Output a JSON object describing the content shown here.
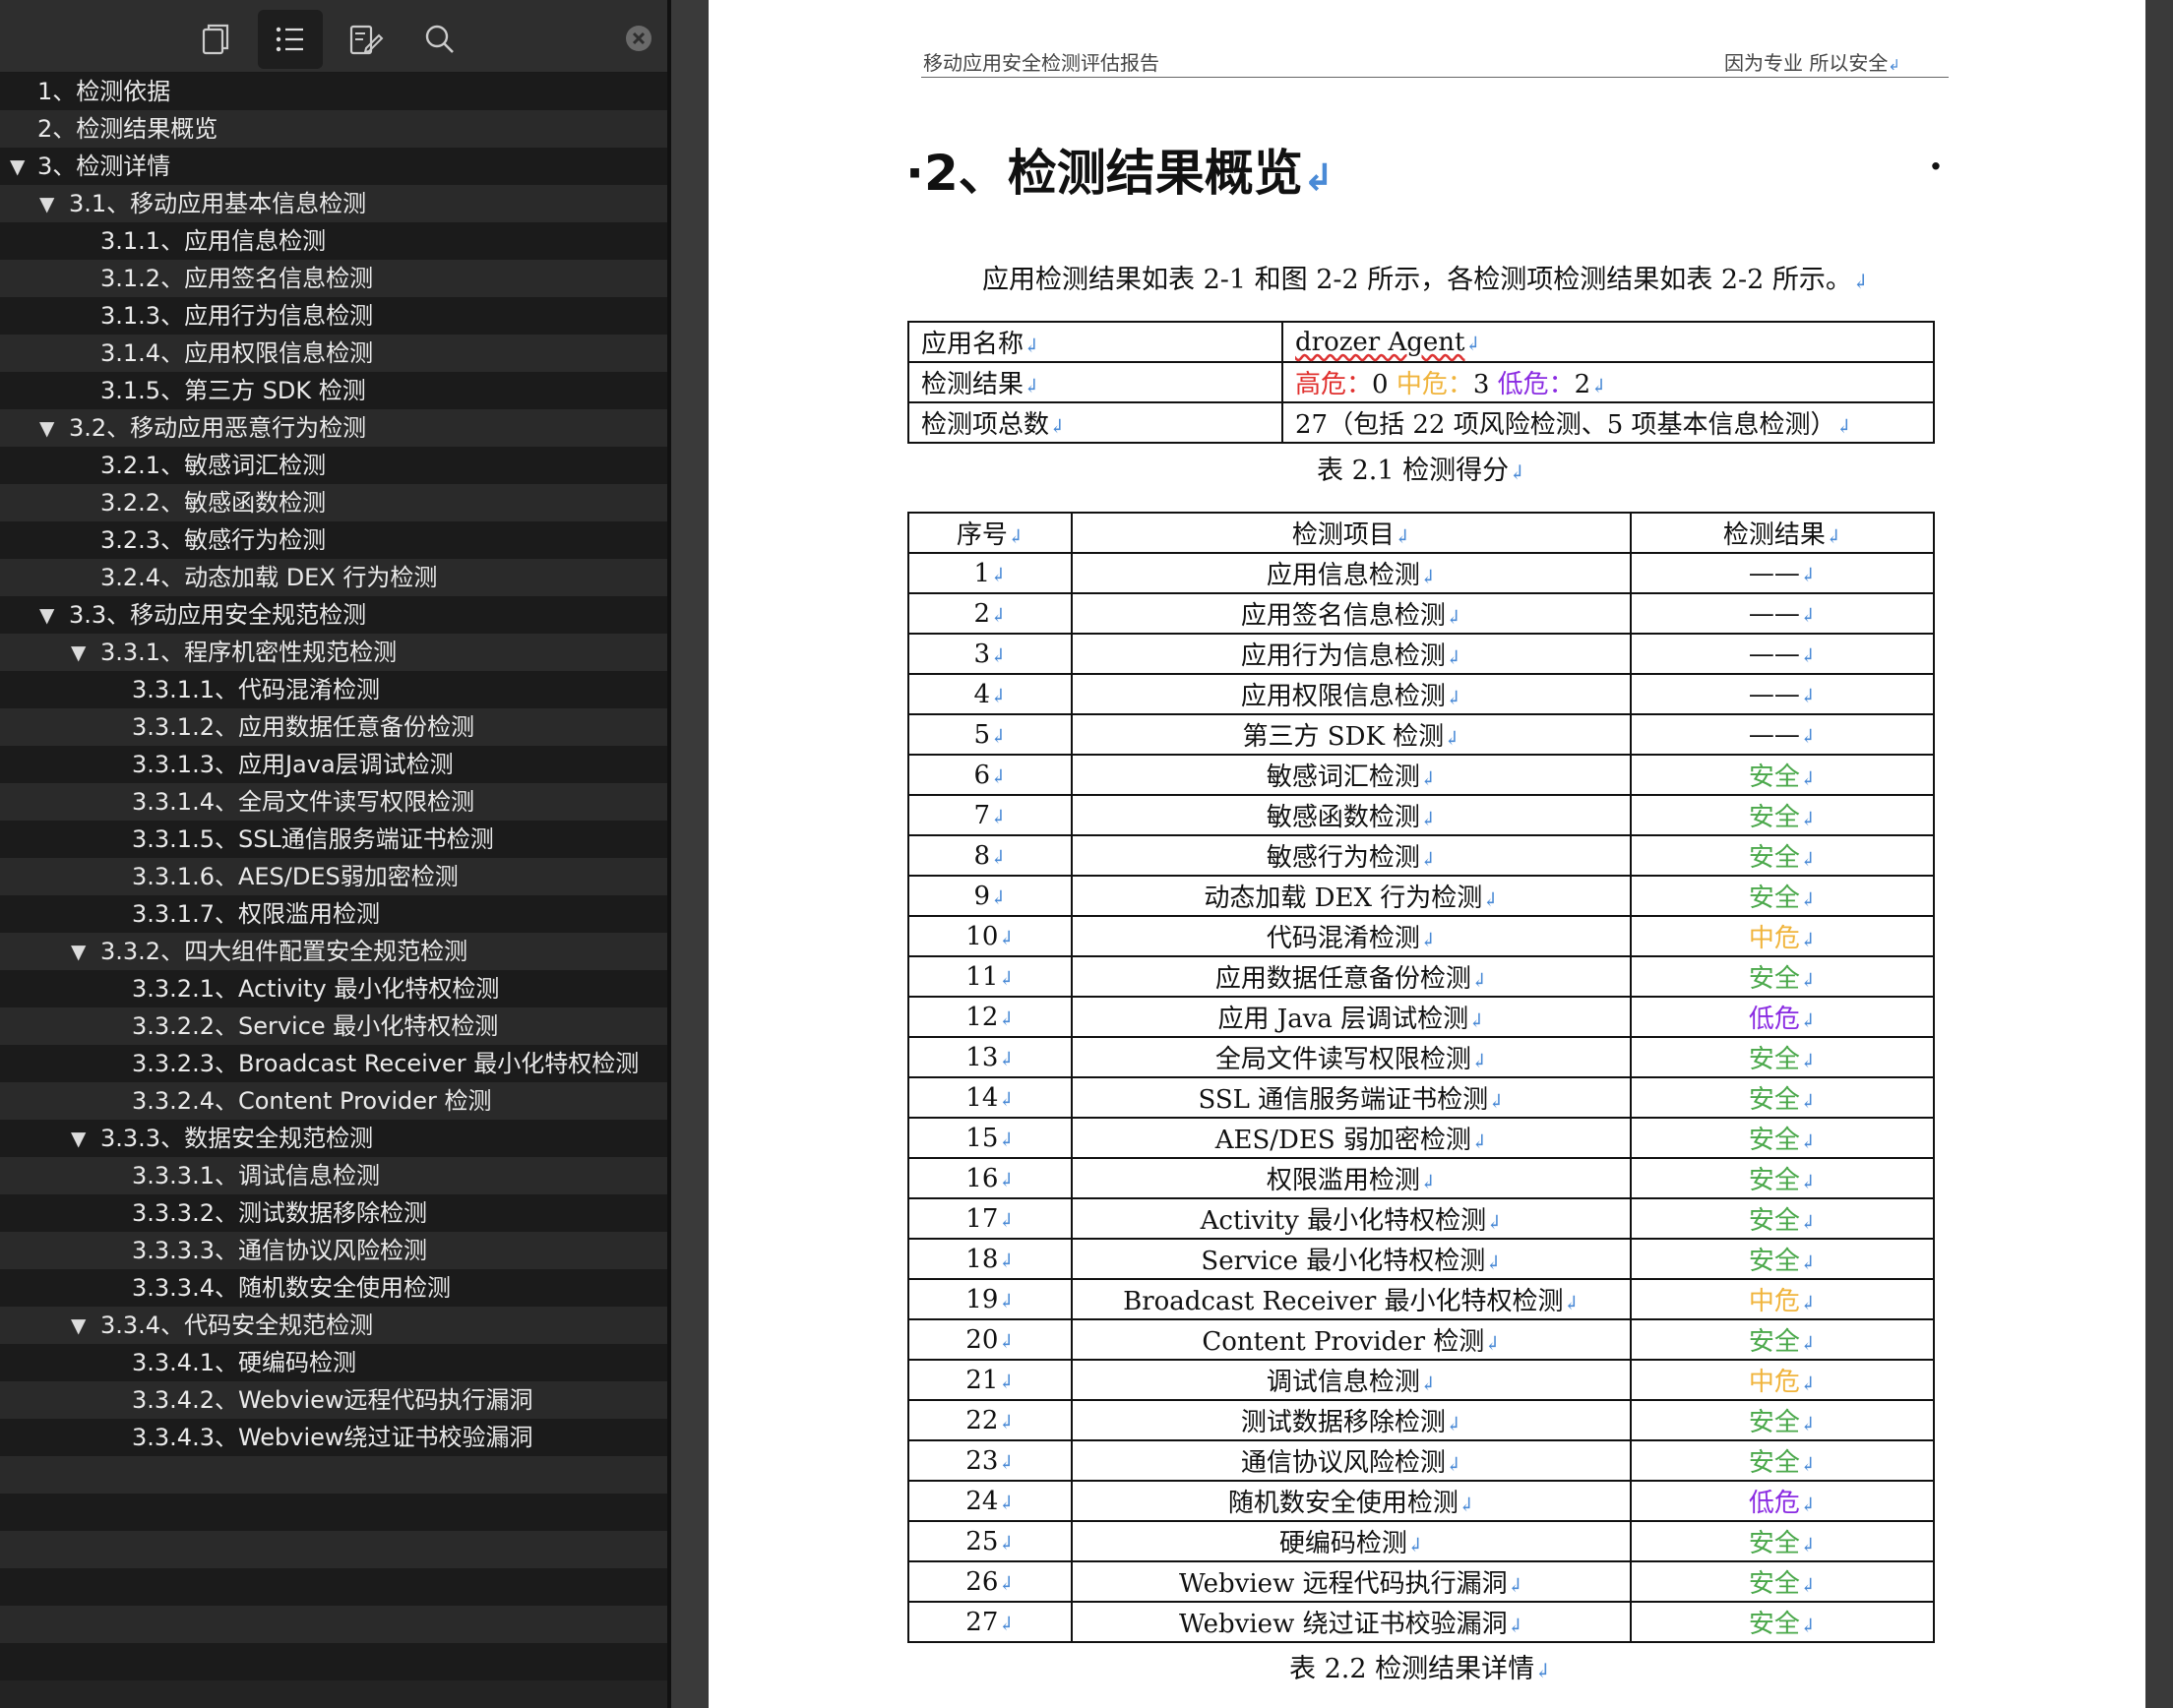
{
  "toolbar": {
    "icons": [
      "pages-icon",
      "outline-icon",
      "annotate-icon",
      "search-icon"
    ],
    "active": "outline-icon",
    "close_icon": "close-icon"
  },
  "outline": [
    {
      "label": "1、检测依据",
      "level": 0,
      "toggle": false
    },
    {
      "label": "2、检测结果概览",
      "level": 0,
      "toggle": false
    },
    {
      "label": "3、检测详情",
      "level": 0,
      "toggle": true
    },
    {
      "label": "3.1、移动应用基本信息检测",
      "level": 1,
      "toggle": true
    },
    {
      "label": "3.1.1、应用信息检测",
      "level": 2,
      "toggle": false
    },
    {
      "label": "3.1.2、应用签名信息检测",
      "level": 2,
      "toggle": false
    },
    {
      "label": "3.1.3、应用行为信息检测",
      "level": 2,
      "toggle": false
    },
    {
      "label": "3.1.4、应用权限信息检测",
      "level": 2,
      "toggle": false
    },
    {
      "label": "3.1.5、第三方 SDK 检测",
      "level": 2,
      "toggle": false
    },
    {
      "label": "3.2、移动应用恶意行为检测",
      "level": 1,
      "toggle": true
    },
    {
      "label": "3.2.1、敏感词汇检测",
      "level": 2,
      "toggle": false
    },
    {
      "label": "3.2.2、敏感函数检测",
      "level": 2,
      "toggle": false
    },
    {
      "label": "3.2.3、敏感行为检测",
      "level": 2,
      "toggle": false
    },
    {
      "label": "3.2.4、动态加载 DEX 行为检测",
      "level": 2,
      "toggle": false
    },
    {
      "label": "3.3、移动应用安全规范检测",
      "level": 1,
      "toggle": true
    },
    {
      "label": "3.3.1、程序机密性规范检测",
      "level": 2,
      "toggle": true
    },
    {
      "label": "3.3.1.1、代码混淆检测",
      "level": 3,
      "toggle": false
    },
    {
      "label": "3.3.1.2、应用数据任意备份检测",
      "level": 3,
      "toggle": false
    },
    {
      "label": "3.3.1.3、应用Java层调试检测",
      "level": 3,
      "toggle": false
    },
    {
      "label": "3.3.1.4、全局文件读写权限检测",
      "level": 3,
      "toggle": false
    },
    {
      "label": "3.3.1.5、SSL通信服务端证书检测",
      "level": 3,
      "toggle": false
    },
    {
      "label": "3.3.1.6、AES/DES弱加密检测",
      "level": 3,
      "toggle": false
    },
    {
      "label": "3.3.1.7、权限滥用检测",
      "level": 3,
      "toggle": false
    },
    {
      "label": "3.3.2、四大组件配置安全规范检测",
      "level": 2,
      "toggle": true
    },
    {
      "label": "3.3.2.1、Activity 最小化特权检测",
      "level": 3,
      "toggle": false
    },
    {
      "label": "3.3.2.2、Service 最小化特权检测",
      "level": 3,
      "toggle": false
    },
    {
      "label": "3.3.2.3、Broadcast Receiver 最小化特权检测",
      "level": 3,
      "toggle": false
    },
    {
      "label": "3.3.2.4、Content Provider 检测",
      "level": 3,
      "toggle": false
    },
    {
      "label": "3.3.3、数据安全规范检测",
      "level": 2,
      "toggle": true
    },
    {
      "label": "3.3.3.1、调试信息检测",
      "level": 3,
      "toggle": false
    },
    {
      "label": "3.3.3.2、测试数据移除检测",
      "level": 3,
      "toggle": false
    },
    {
      "label": "3.3.3.3、通信协议风险检测",
      "level": 3,
      "toggle": false
    },
    {
      "label": "3.3.3.4、随机数安全使用检测",
      "level": 3,
      "toggle": false
    },
    {
      "label": "3.3.4、代码安全规范检测",
      "level": 2,
      "toggle": true
    },
    {
      "label": "3.3.4.1、硬编码检测",
      "level": 3,
      "toggle": false
    },
    {
      "label": "3.3.4.2、Webview远程代码执行漏洞",
      "level": 3,
      "toggle": false
    },
    {
      "label": "3.3.4.3、Webview绕过证书校验漏洞",
      "level": 3,
      "toggle": false
    }
  ],
  "page": {
    "header_left": "移动应用安全检测评估报告",
    "header_right": "因为专业 所以安全",
    "heading": "2、检测结果概览",
    "intro": "应用检测结果如表 2-1 和图 2-2 所示，各检测项检测结果如表 2-2 所示。",
    "summary": {
      "app_name_label": "应用名称",
      "app_name": "drozer Agent",
      "result_label": "检测结果",
      "high_label": "高危：",
      "high_value": "0",
      "mid_label": "中危：",
      "mid_value": "3",
      "low_label": "低危：",
      "low_value": "2",
      "total_label": "检测项总数",
      "total_value": "27（包括 22 项风险检测、5 项基本信息检测）",
      "caption": "表 2.1  检测得分"
    },
    "details": {
      "col_no": "序号",
      "col_item": "检测项目",
      "col_result": "检测结果",
      "caption": "表 2.2  检测结果详情",
      "rows": [
        {
          "no": "1",
          "item": "应用信息检测",
          "result": "——",
          "level": "none"
        },
        {
          "no": "2",
          "item": "应用签名信息检测",
          "result": "——",
          "level": "none"
        },
        {
          "no": "3",
          "item": "应用行为信息检测",
          "result": "——",
          "level": "none"
        },
        {
          "no": "4",
          "item": "应用权限信息检测",
          "result": "——",
          "level": "none"
        },
        {
          "no": "5",
          "item": "第三方 SDK 检测",
          "result": "——",
          "level": "none"
        },
        {
          "no": "6",
          "item": "敏感词汇检测",
          "result": "安全",
          "level": "safe"
        },
        {
          "no": "7",
          "item": "敏感函数检测",
          "result": "安全",
          "level": "safe"
        },
        {
          "no": "8",
          "item": "敏感行为检测",
          "result": "安全",
          "level": "safe"
        },
        {
          "no": "9",
          "item": "动态加载 DEX 行为检测",
          "result": "安全",
          "level": "safe"
        },
        {
          "no": "10",
          "item": "代码混淆检测",
          "result": "中危",
          "level": "mid"
        },
        {
          "no": "11",
          "item": "应用数据任意备份检测",
          "result": "安全",
          "level": "safe"
        },
        {
          "no": "12",
          "item": "应用 Java 层调试检测",
          "result": "低危",
          "level": "low"
        },
        {
          "no": "13",
          "item": "全局文件读写权限检测",
          "result": "安全",
          "level": "safe"
        },
        {
          "no": "14",
          "item": "SSL 通信服务端证书检测",
          "result": "安全",
          "level": "safe"
        },
        {
          "no": "15",
          "item": "AES/DES 弱加密检测",
          "result": "安全",
          "level": "safe"
        },
        {
          "no": "16",
          "item": "权限滥用检测",
          "result": "安全",
          "level": "safe"
        },
        {
          "no": "17",
          "item": "Activity 最小化特权检测",
          "result": "安全",
          "level": "safe"
        },
        {
          "no": "18",
          "item": "Service 最小化特权检测",
          "result": "安全",
          "level": "safe"
        },
        {
          "no": "19",
          "item": "Broadcast Receiver 最小化特权检测",
          "result": "中危",
          "level": "mid"
        },
        {
          "no": "20",
          "item": "Content Provider 检测",
          "result": "安全",
          "level": "safe"
        },
        {
          "no": "21",
          "item": "调试信息检测",
          "result": "中危",
          "level": "mid"
        },
        {
          "no": "22",
          "item": "测试数据移除检测",
          "result": "安全",
          "level": "safe"
        },
        {
          "no": "23",
          "item": "通信协议风险检测",
          "result": "安全",
          "level": "safe"
        },
        {
          "no": "24",
          "item": "随机数安全使用检测",
          "result": "低危",
          "level": "low"
        },
        {
          "no": "25",
          "item": "硬编码检测",
          "result": "安全",
          "level": "safe"
        },
        {
          "no": "26",
          "item": "Webview 远程代码执行漏洞",
          "result": "安全",
          "level": "safe"
        },
        {
          "no": "27",
          "item": "Webview 绕过证书校验漏洞",
          "result": "安全",
          "level": "safe"
        }
      ]
    }
  },
  "colors": {
    "high": "#e0302e",
    "mid": "#f0b43c",
    "low": "#8a2be2",
    "safe": "#4aa84a",
    "mark": "#4a8ad6"
  }
}
